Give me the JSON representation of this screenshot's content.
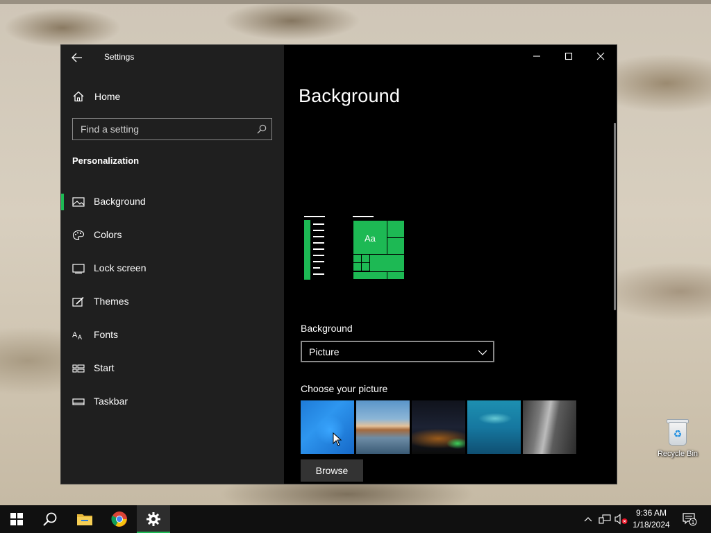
{
  "desktop": {
    "recycle_bin_label": "Recycle Bin"
  },
  "window": {
    "title": "Settings",
    "sidebar": {
      "home_label": "Home",
      "search_placeholder": "Find a setting",
      "section_title": "Personalization",
      "items": [
        {
          "label": "Background",
          "icon": "picture-icon",
          "selected": true
        },
        {
          "label": "Colors",
          "icon": "palette-icon",
          "selected": false
        },
        {
          "label": "Lock screen",
          "icon": "lock-screen-icon",
          "selected": false
        },
        {
          "label": "Themes",
          "icon": "themes-icon",
          "selected": false
        },
        {
          "label": "Fonts",
          "icon": "fonts-icon",
          "selected": false
        },
        {
          "label": "Start",
          "icon": "start-icon",
          "selected": false
        },
        {
          "label": "Taskbar",
          "icon": "taskbar-icon",
          "selected": false
        }
      ]
    },
    "main": {
      "page_title": "Background",
      "preview_tile_text": "Aa",
      "background_label": "Background",
      "background_value": "Picture",
      "choose_picture_label": "Choose your picture",
      "pictures": [
        "windows-blue",
        "beach-rock-arch",
        "night-sky-tent",
        "underwater-swimmer",
        "rock-cliff"
      ],
      "browse_label": "Browse"
    }
  },
  "taskbar": {
    "pinned": [
      "start-button",
      "search-button",
      "file-explorer",
      "chrome",
      "settings"
    ],
    "active": "settings",
    "time": "9:36 AM",
    "date": "1/18/2024",
    "notification_count": "1"
  },
  "colors": {
    "accent": "#1db954",
    "sidebar_bg": "#1f1f1f",
    "main_bg": "#000000",
    "taskbar_bg": "#101010"
  }
}
